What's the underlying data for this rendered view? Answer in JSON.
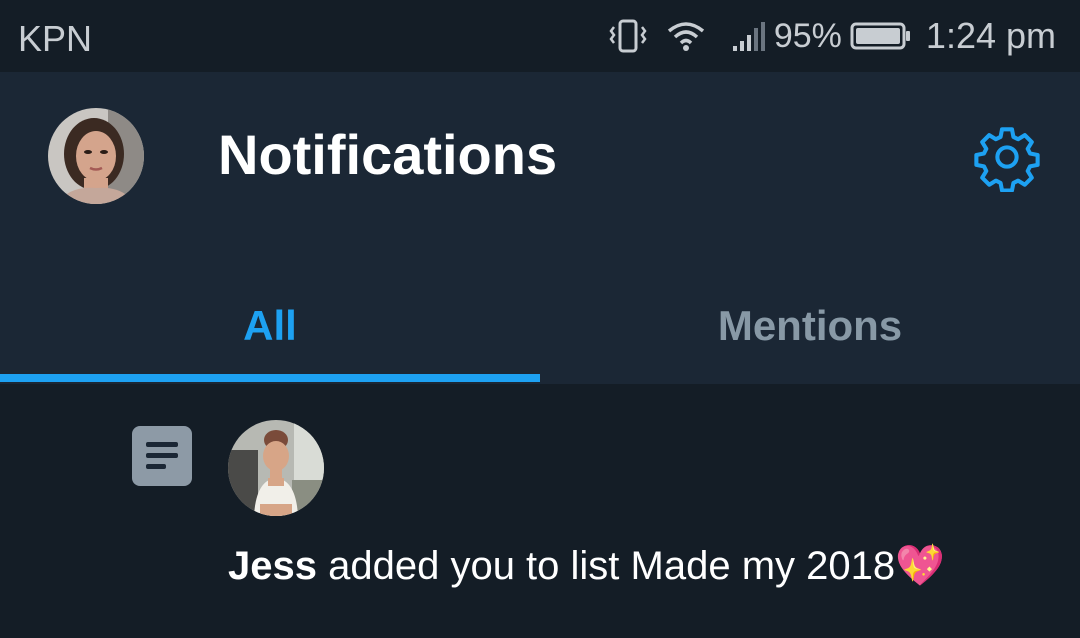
{
  "status_bar": {
    "carrier": "KPN",
    "battery_percent": "95%",
    "time": "1:24 pm",
    "icons": [
      "vibrate-icon",
      "wifi-icon",
      "signal-icon",
      "battery-icon"
    ]
  },
  "header": {
    "title": "Notifications",
    "settings_icon": "gear-icon",
    "accent_color": "#1da1f2"
  },
  "tabs": [
    {
      "label": "All",
      "active": true
    },
    {
      "label": "Mentions",
      "active": false
    }
  ],
  "notifications": [
    {
      "type_icon": "list-icon",
      "user": "Jess",
      "text": " added you to list Made my 2018",
      "emoji": "💖"
    }
  ]
}
